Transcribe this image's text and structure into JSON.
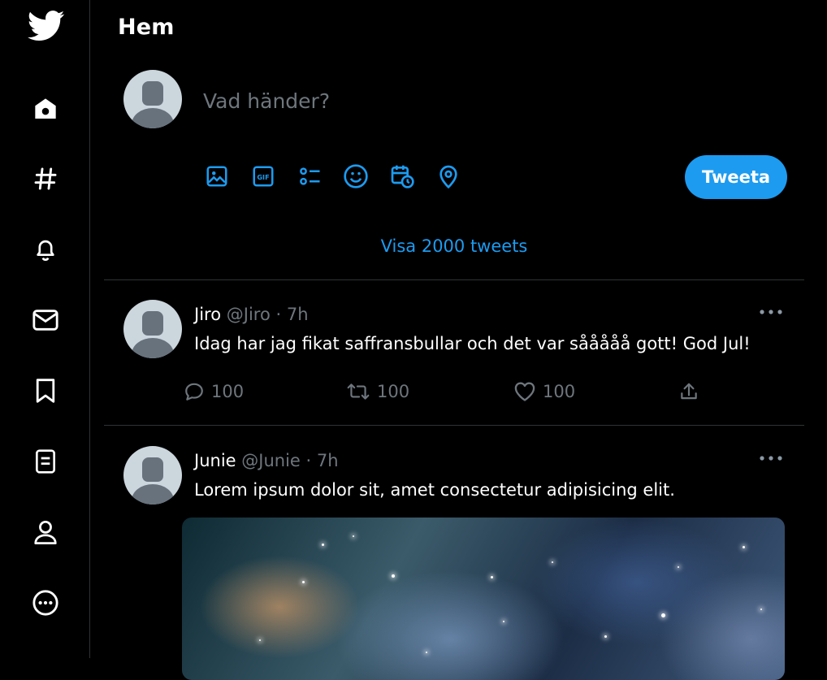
{
  "header": {
    "title": "Hem"
  },
  "nav": {
    "items": [
      {
        "name": "home"
      },
      {
        "name": "explore"
      },
      {
        "name": "notifications"
      },
      {
        "name": "messages"
      },
      {
        "name": "bookmarks"
      },
      {
        "name": "lists"
      },
      {
        "name": "profile"
      },
      {
        "name": "more"
      }
    ]
  },
  "composer": {
    "placeholder": "Vad händer?",
    "tweet_button": "Tweeta",
    "tools": [
      "image-icon",
      "gif-icon",
      "poll-icon",
      "emoji-icon",
      "schedule-icon",
      "location-icon"
    ]
  },
  "feed": {
    "show_more": "Visa 2000 tweets",
    "tweets": [
      {
        "name": "Jiro",
        "handle": "@Jiro",
        "dot": "·",
        "time": "7h",
        "text": "Idag har jag fikat saffransbullar och det var sååååå gott! God Jul!",
        "replies": "100",
        "retweets": "100",
        "likes": "100"
      },
      {
        "name": "Junie",
        "handle": "@Junie",
        "dot": "·",
        "time": "7h",
        "text": "Lorem ipsum dolor sit, amet consectetur adipisicing elit."
      }
    ]
  },
  "colors": {
    "accent": "#1d9bf0",
    "background": "#000000",
    "muted": "#6e767d",
    "border": "#2f3336"
  }
}
